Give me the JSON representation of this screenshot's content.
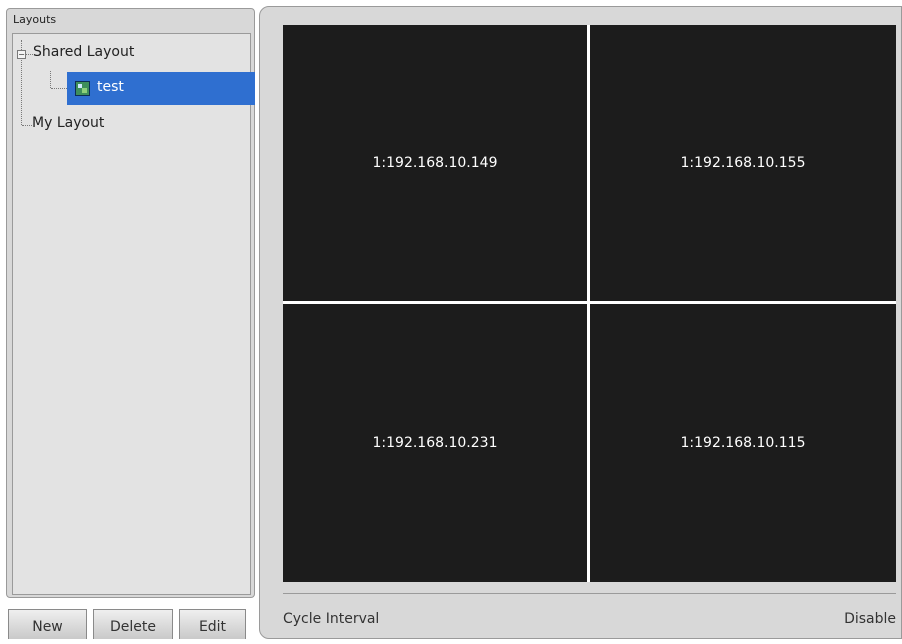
{
  "layouts_panel": {
    "title": "Layouts",
    "tree": {
      "shared_layout": {
        "label": "Shared Layout",
        "toggle": "−",
        "children": [
          {
            "label": "test",
            "icon": "layout-icon",
            "selected": true
          }
        ]
      },
      "my_layout": {
        "label": "My Layout"
      }
    },
    "buttons": {
      "new": "New",
      "delete": "Delete",
      "edit": "Edit"
    },
    "selection_color": "#2f6fd0"
  },
  "video_grid": {
    "cells": [
      {
        "label": "1:192.168.10.149"
      },
      {
        "label": "1:192.168.10.155"
      },
      {
        "label": "1:192.168.10.231"
      },
      {
        "label": "1:192.168.10.115"
      }
    ]
  },
  "status_bar": {
    "cycle_label": "Cycle Interval",
    "cycle_value": "Disable"
  }
}
